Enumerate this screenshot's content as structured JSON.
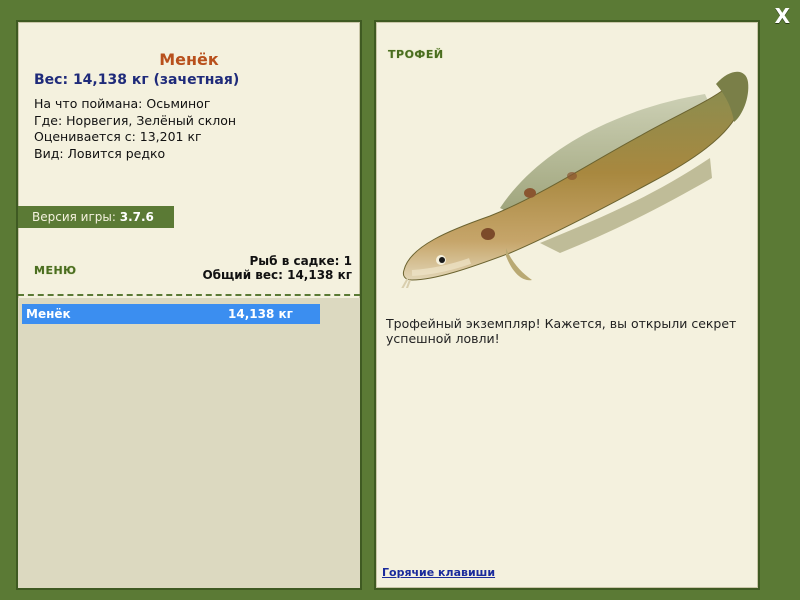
{
  "close_label": "X",
  "fish": {
    "name": "Менёк",
    "weight_line": "Вес: 14,138 кг (зачетная)",
    "caught_on": "На что поймана: Осьминог",
    "where": "Где: Норвегия, Зелёный склон",
    "rated_from": "Оценивается с: 13,201 кг",
    "kind": "Вид: Ловится редко"
  },
  "version": {
    "label": "Версия игры:",
    "value": "3.7.6"
  },
  "menu_label": "МЕНЮ",
  "keepnet": {
    "count_line": "Рыб в садке: 1",
    "total_line": "Общий вес: 14,138 кг"
  },
  "catch_list": [
    {
      "name": "Менёк",
      "weight": "14,138 кг"
    }
  ],
  "trophy": {
    "label": "ТРОФЕЙ",
    "text": "Трофейный экземпляр! Кажется, вы открыли секрет успешной ловли!"
  },
  "hotkeys_label": "Горячие клавиши",
  "colors": {
    "frame": "#5b7a35",
    "panel": "#f4f1de",
    "name": "#b8501c",
    "weight": "#1f2b7a",
    "selected_row": "#3b8ef0"
  },
  "icons": {
    "close": "close-icon",
    "fish": "burbot-fish-image"
  }
}
